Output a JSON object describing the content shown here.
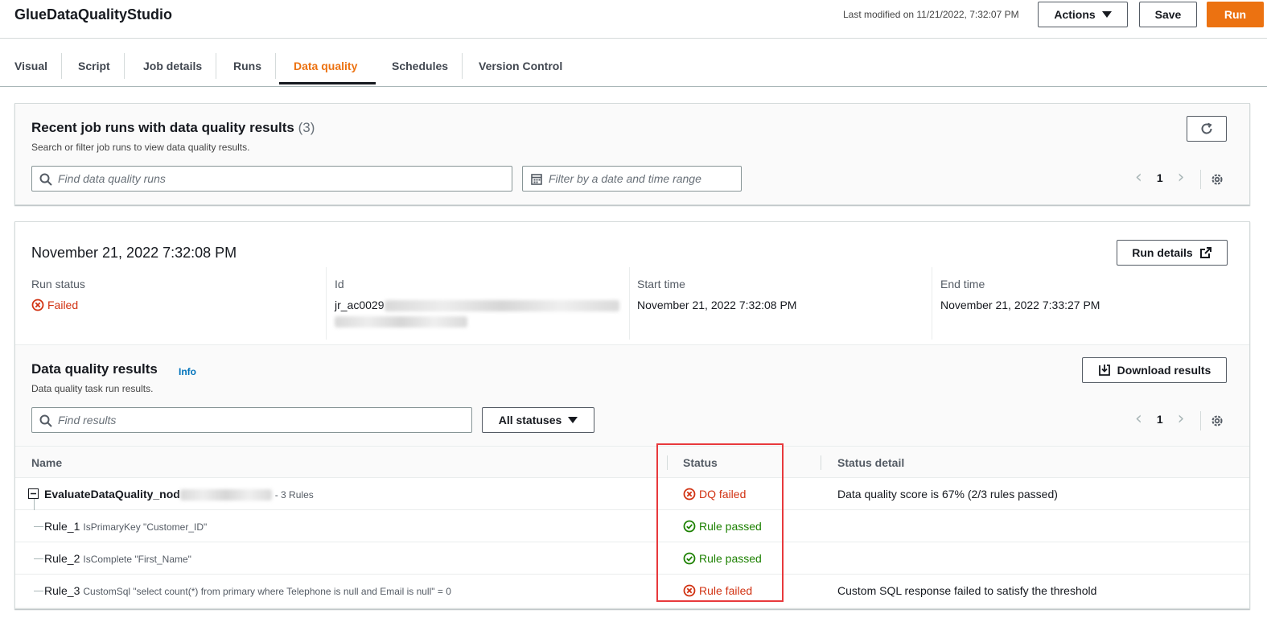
{
  "header": {
    "title": "GlueDataQualityStudio",
    "last_modified": "Last modified on 11/21/2022, 7:32:07 PM",
    "actions_label": "Actions",
    "save_label": "Save",
    "run_label": "Run"
  },
  "tabs": [
    {
      "label": "Visual"
    },
    {
      "label": "Script"
    },
    {
      "label": "Job details"
    },
    {
      "label": "Runs"
    },
    {
      "label": "Data quality",
      "active": true
    },
    {
      "label": "Schedules"
    },
    {
      "label": "Version Control"
    }
  ],
  "recent_runs": {
    "title": "Recent job runs with data quality results",
    "count": "(3)",
    "description": "Search or filter job runs to view data quality results.",
    "search_placeholder": "Find data quality runs",
    "date_filter_placeholder": "Filter by a date and time range",
    "page": "1"
  },
  "run": {
    "date": "November 21, 2022 7:32:08 PM",
    "run_details_label": "Run details",
    "run_status_label": "Run status",
    "run_status_value": "Failed",
    "id_label": "Id",
    "id_value_visible": "jr_ac0029",
    "start_time_label": "Start time",
    "start_time_value": "November 21, 2022 7:32:08 PM",
    "end_time_label": "End time",
    "end_time_value": "November 21, 2022 7:33:27 PM"
  },
  "dq_results": {
    "title": "Data quality results",
    "info_label": "Info",
    "description": "Data quality task run results.",
    "download_label": "Download results",
    "search_placeholder": "Find results",
    "status_filter": "All statuses",
    "page": "1",
    "columns": {
      "name": "Name",
      "status": "Status",
      "status_detail": "Status detail"
    },
    "rows": [
      {
        "name": "EvaluateDataQuality_nod",
        "suffix": "- 3 Rules",
        "status": "DQ failed",
        "detail": "Data quality score is 67% (2/3 rules passed)"
      },
      {
        "name": "Rule_1",
        "definition": "IsPrimaryKey \"Customer_ID\"",
        "status": "Rule passed",
        "detail": ""
      },
      {
        "name": "Rule_2",
        "definition": "IsComplete \"First_Name\"",
        "status": "Rule passed",
        "detail": ""
      },
      {
        "name": "Rule_3",
        "definition": "CustomSql \"select count(*) from primary where Telephone is null and Email is null\" = 0",
        "status": "Rule failed",
        "detail": "Custom SQL response failed to satisfy the threshold"
      }
    ]
  },
  "colors": {
    "accent": "#ec7211",
    "fail": "#d13212",
    "pass": "#1d8102",
    "link": "#0073bb",
    "highlight": "#e8393c"
  }
}
